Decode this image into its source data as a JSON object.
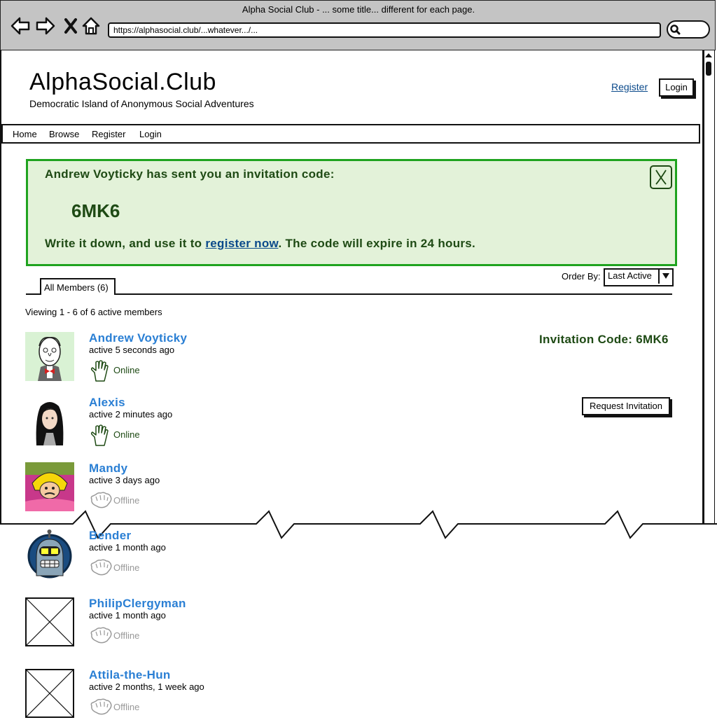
{
  "window": {
    "title": "Alpha Social Club - ... some title... different for each page.",
    "url": "https://alphasocial.club/...whatever.../..."
  },
  "header": {
    "site_title": "AlphaSocial.Club",
    "tagline": "Democratic Island of Anonymous Social Adventures",
    "register_label": "Register",
    "login_label": "Login"
  },
  "nav": {
    "items": [
      {
        "label": "Home"
      },
      {
        "label": "Browse"
      },
      {
        "label": "Register"
      },
      {
        "label": "Login"
      }
    ]
  },
  "alert": {
    "line1": "Andrew Voyticky has sent you an invitation code:",
    "code": "6MK6",
    "line2_pre": "Write it down, and use it to ",
    "line2_link": "register now",
    "line2_post": ". The code will expire in 24 hours.",
    "close_label": "X"
  },
  "members": {
    "tab_label": "All Members (6)",
    "order_by_label": "Order By:",
    "order_by_value": "Last Active",
    "viewing_text": "Viewing 1 - 6 of 6 active members",
    "invitation_code_label": "Invitation Code: 6MK6",
    "request_invitation_label": "Request Invitation",
    "list": [
      {
        "name": "Andrew Voyticky",
        "active": "active 5 seconds ago",
        "status": "Online"
      },
      {
        "name": "Alexis",
        "active": "active 2 minutes ago",
        "status": "Online"
      },
      {
        "name": "Mandy",
        "active": "active 3 days ago",
        "status": "Offline"
      },
      {
        "name": "Bender",
        "active": "active 1 month ago",
        "status": "Offline"
      },
      {
        "name": "PhilipClergyman",
        "active": "active 1 month ago",
        "status": "Offline"
      },
      {
        "name": "Attila-the-Hun",
        "active": "active 2 months, 1 week ago",
        "status": "Offline"
      }
    ]
  },
  "colors": {
    "alert_bg": "#e3f2d9",
    "alert_border": "#1fa31f",
    "alert_text": "#1e4a14",
    "member_name": "#2a7fd4",
    "link": "#0b4a8b"
  }
}
